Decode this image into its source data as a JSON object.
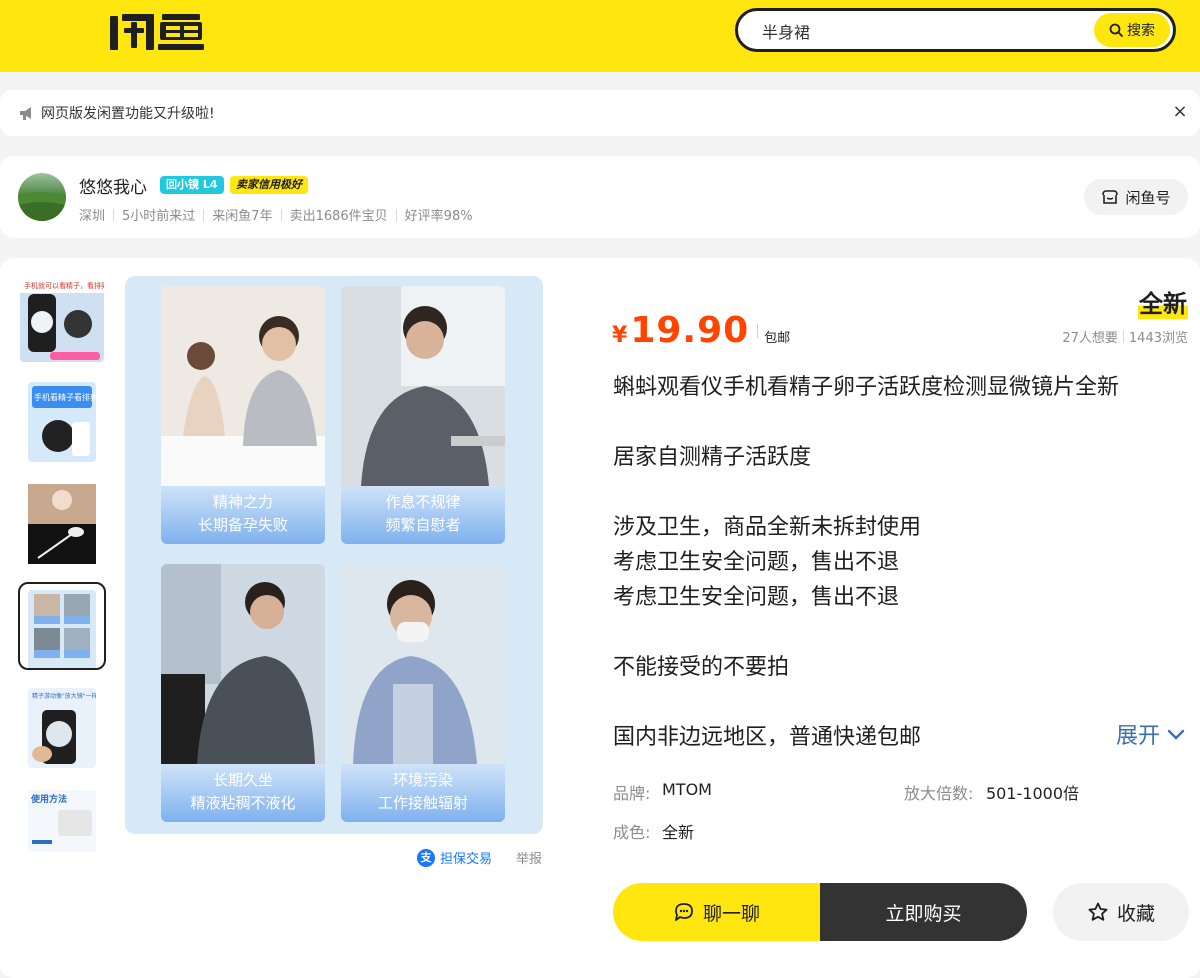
{
  "header": {
    "logo_text": "闲鱼",
    "search": {
      "value": "半身裙",
      "button_label": "搜索"
    }
  },
  "notice": {
    "text": "网页版发闲置功能又升级啦!",
    "close": "×"
  },
  "seller": {
    "name": "悠悠我心",
    "level_badge": "回小镜 L4",
    "credit_badge": "卖家信用极好",
    "meta": [
      "深圳",
      "5小时前来过",
      "来闲鱼7年",
      "卖出1686件宝贝",
      "好评率98%"
    ],
    "xianyu_button": "闲鱼号"
  },
  "gallery": {
    "thumbnails": [
      {
        "name": "thumb-1",
        "caption": "手机就可以看精子，看排卵",
        "active": false
      },
      {
        "name": "thumb-2",
        "caption": "手机看精子看排卵",
        "active": false
      },
      {
        "name": "thumb-3",
        "caption": "",
        "active": false
      },
      {
        "name": "thumb-4",
        "caption": "",
        "active": true
      },
      {
        "name": "thumb-5",
        "caption": "精子游动像\"放大镜\"一样清晰可见",
        "active": false
      },
      {
        "name": "thumb-6",
        "caption": "使用方法",
        "active": false
      }
    ],
    "panels": [
      {
        "line1": "精神之力",
        "line2": "长期备孕失败"
      },
      {
        "line1": "作息不规律",
        "line2": "频繁自慰者"
      },
      {
        "line1": "长期久坐",
        "line2": "精液粘稠不液化"
      },
      {
        "line1": "环境污染",
        "line2": "工作接触辐射"
      }
    ],
    "guarantee": "担保交易",
    "alipay_glyph": "支",
    "report": "举报"
  },
  "product": {
    "currency": "¥",
    "price": "19.90",
    "shipping": "包邮",
    "condition": "全新",
    "wants": "27人想要",
    "views": "1443浏览",
    "title": "蝌蚪观看仪手机看精子卵子活跃度检测显微镜片全新",
    "desc_lines": [
      "居家自测精子活跃度",
      "涉及卫生，商品全新未拆封使用",
      "考虑卫生安全问题，售出不退",
      "考虑卫生安全问题，售出不退",
      "不能接受的不要拍",
      "国内非边远地区，普通快递包邮"
    ],
    "expand": "展开",
    "attrs": {
      "brand_label": "品牌:",
      "brand_value": "MTOM",
      "zoom_label": "放大倍数:",
      "zoom_value": "501-1000倍",
      "cond_label": "成色:",
      "cond_value": "全新"
    }
  },
  "actions": {
    "chat": "聊一聊",
    "buy": "立即购买",
    "favorite": "收藏"
  },
  "colors": {
    "brand_yellow": "#ffe60f",
    "price_red": "#ff4400",
    "link_blue": "#1677ff"
  }
}
